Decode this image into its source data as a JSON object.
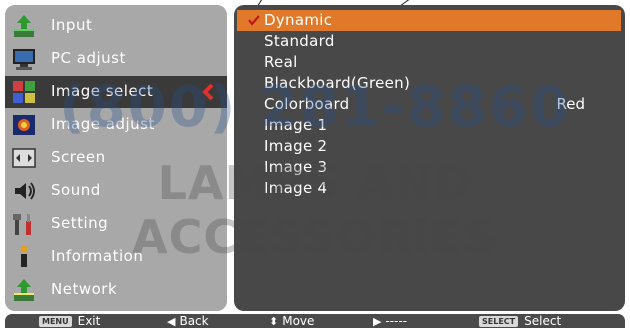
{
  "sidebar": {
    "items": [
      {
        "label": "Input",
        "icon": "input-icon"
      },
      {
        "label": "PC adjust",
        "icon": "pc-adjust-icon"
      },
      {
        "label": "Image select",
        "icon": "image-select-icon",
        "selected": true
      },
      {
        "label": "Image adjust",
        "icon": "image-adjust-icon"
      },
      {
        "label": "Screen",
        "icon": "screen-icon"
      },
      {
        "label": "Sound",
        "icon": "sound-icon"
      },
      {
        "label": "Setting",
        "icon": "setting-icon"
      },
      {
        "label": "Information",
        "icon": "information-icon"
      },
      {
        "label": "Network",
        "icon": "network-icon"
      }
    ]
  },
  "options": [
    {
      "label": "Dynamic",
      "active": true,
      "checked": true
    },
    {
      "label": "Standard"
    },
    {
      "label": "Real"
    },
    {
      "label": "Blackboard(Green)"
    },
    {
      "label": "Colorboard",
      "value": "Red"
    },
    {
      "label": "Image 1"
    },
    {
      "label": "Image 2"
    },
    {
      "label": "Image 3"
    },
    {
      "label": "Image 4"
    }
  ],
  "watermark": {
    "line1": "(800) 281-8860",
    "line2": "LAMPS AND ACCESSORIES"
  },
  "bottom_bar": {
    "exit_key": "MENU",
    "exit_label": "Exit",
    "back_label": "Back",
    "move_label": "Move",
    "next_label": "-----",
    "select_key": "SELECT",
    "select_label": "Select"
  },
  "colors": {
    "highlight": "#e07a2a",
    "sidebar_bg": "#a8a8a8",
    "content_bg": "#484848",
    "selected_bg": "#3a3a3a",
    "arrow": "#e03030"
  }
}
